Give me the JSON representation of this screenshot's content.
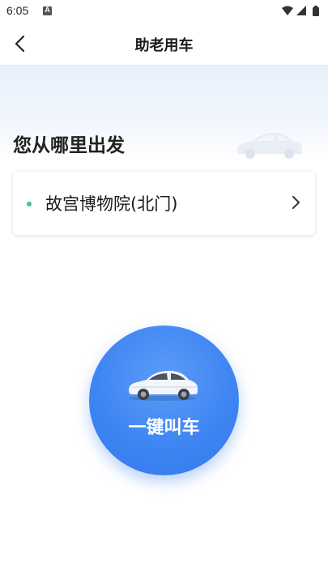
{
  "status_bar": {
    "time": "6:05",
    "notification_icon": "a-square-icon",
    "icons": [
      "wifi-icon",
      "signal-icon",
      "battery-icon"
    ]
  },
  "nav": {
    "title": "助老用车",
    "back_icon": "chevron-left-icon"
  },
  "hero": {
    "title": "您从哪里出发"
  },
  "location": {
    "name": "故宫博物院(北门)",
    "dot_color": "#3cc690"
  },
  "call": {
    "label": "一键叫车",
    "button_color": "#3d84f2"
  }
}
